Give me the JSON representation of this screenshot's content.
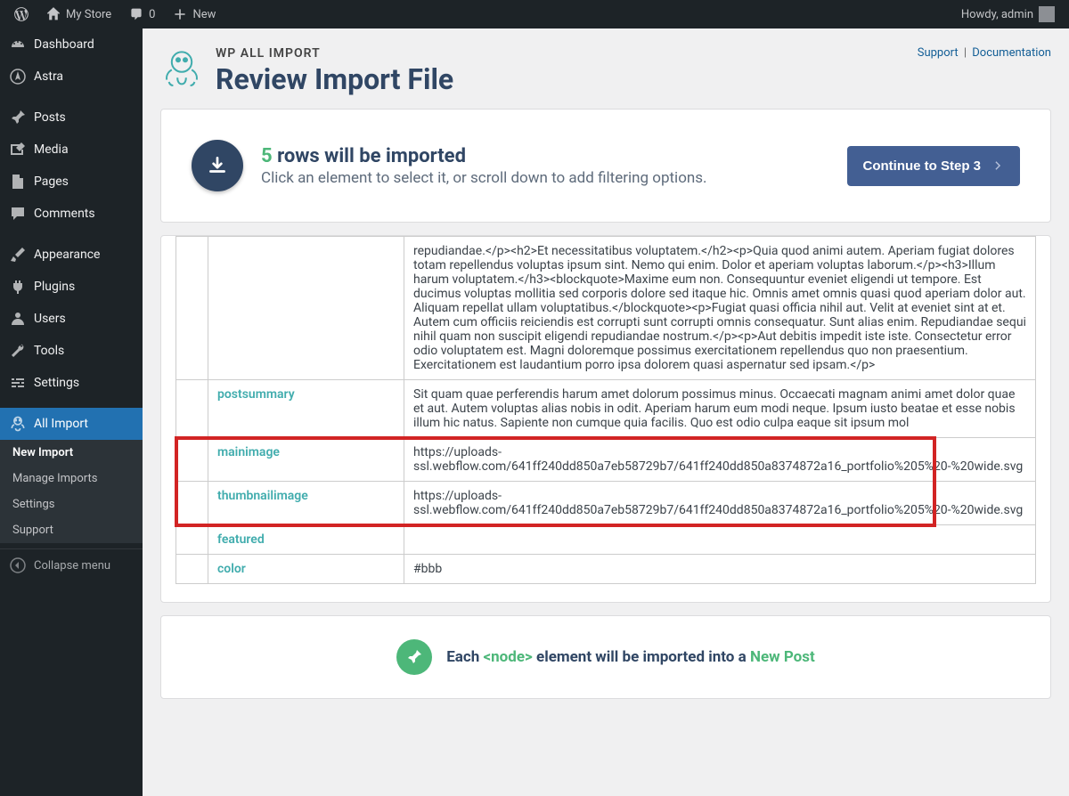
{
  "adminBar": {
    "site": "My Store",
    "comments": "0",
    "new": "New",
    "howdy": "Howdy, admin"
  },
  "sidebar": {
    "items": [
      {
        "label": "Dashboard",
        "icon": "dashboard"
      },
      {
        "label": "Astra",
        "icon": "astra"
      },
      {
        "label": "Posts",
        "icon": "pin"
      },
      {
        "label": "Media",
        "icon": "media"
      },
      {
        "label": "Pages",
        "icon": "page"
      },
      {
        "label": "Comments",
        "icon": "comment"
      },
      {
        "label": "Appearance",
        "icon": "brush"
      },
      {
        "label": "Plugins",
        "icon": "plug"
      },
      {
        "label": "Users",
        "icon": "user"
      },
      {
        "label": "Tools",
        "icon": "wrench"
      },
      {
        "label": "Settings",
        "icon": "sliders"
      },
      {
        "label": "All Import",
        "icon": "import"
      }
    ],
    "submenu": [
      "New Import",
      "Manage Imports",
      "Settings",
      "Support"
    ],
    "collapse": "Collapse menu"
  },
  "header": {
    "brand": "WP ALL IMPORT",
    "title": "Review Import File",
    "support": "Support",
    "docs": "Documentation"
  },
  "info": {
    "count": "5",
    "countSuffix": "rows will be imported",
    "subtitle": "Click an element to select it, or scroll down to add filtering options.",
    "button": "Continue to Step 3"
  },
  "table": {
    "rows": [
      {
        "key": "",
        "value": "repudiandae.</p><h2>Et necessitatibus voluptatem.</h2><p>Quia quod animi autem. Aperiam fugiat dolores totam repellendus voluptas ipsum sint. Nemo qui enim. Dolor et aperiam voluptas laborum.</p><h3>Illum harum voluptatem.</h3><blockquote>Maxime eum non. Consequuntur eveniet eligendi ut tempore. Est ducimus voluptas mollitia sed corporis dolore sed itaque hic. Omnis amet omnis quasi quod aperiam dolor aut. Aliquam repellat ullam voluptatibus.</blockquote><p>Fugiat quasi officia nihil aut. Velit at eveniet sint at et. Autem cum officiis reiciendis est corrupti sunt corrupti omnis consequatur. Sunt alias enim. Repudiandae sequi nihil quam non suscipit eligendi repudiandae nostrum.</p><p>Aut debitis impedit iste iste. Consectetur error odio voluptatem est. Magni doloremque possimus exercitationem repellendus quo non praesentium. Exercitationem est laudantium porro ipsa dolorem quasi aspernatur sed ipsam.</p>"
      },
      {
        "key": "postsummary",
        "value": "Sit quam quae perferendis harum amet dolorum possimus minus. Occaecati magnam animi amet dolor quae et aut. Autem voluptas alias nobis in odit. Aperiam harum eum modi neque. Ipsum iusto beatae et esse nobis illum hic natus. Sapiente non cumque quia facilis. Quo est odio culpa eaque sit ipsum mol"
      },
      {
        "key": "mainimage",
        "value": "https://uploads-ssl.webflow.com/641ff240dd850a7eb58729b7/641ff240dd850a8374872a16_portfolio%205%20-%20wide.svg"
      },
      {
        "key": "thumbnailimage",
        "value": "https://uploads-ssl.webflow.com/641ff240dd850a7eb58729b7/641ff240dd850a8374872a16_portfolio%205%20-%20wide.svg"
      },
      {
        "key": "featured",
        "value": ""
      },
      {
        "key": "color",
        "value": "#bbb"
      }
    ]
  },
  "footer": {
    "prefix": "Each ",
    "node": "<node>",
    "mid": " element will be imported into a ",
    "post": "New Post"
  }
}
